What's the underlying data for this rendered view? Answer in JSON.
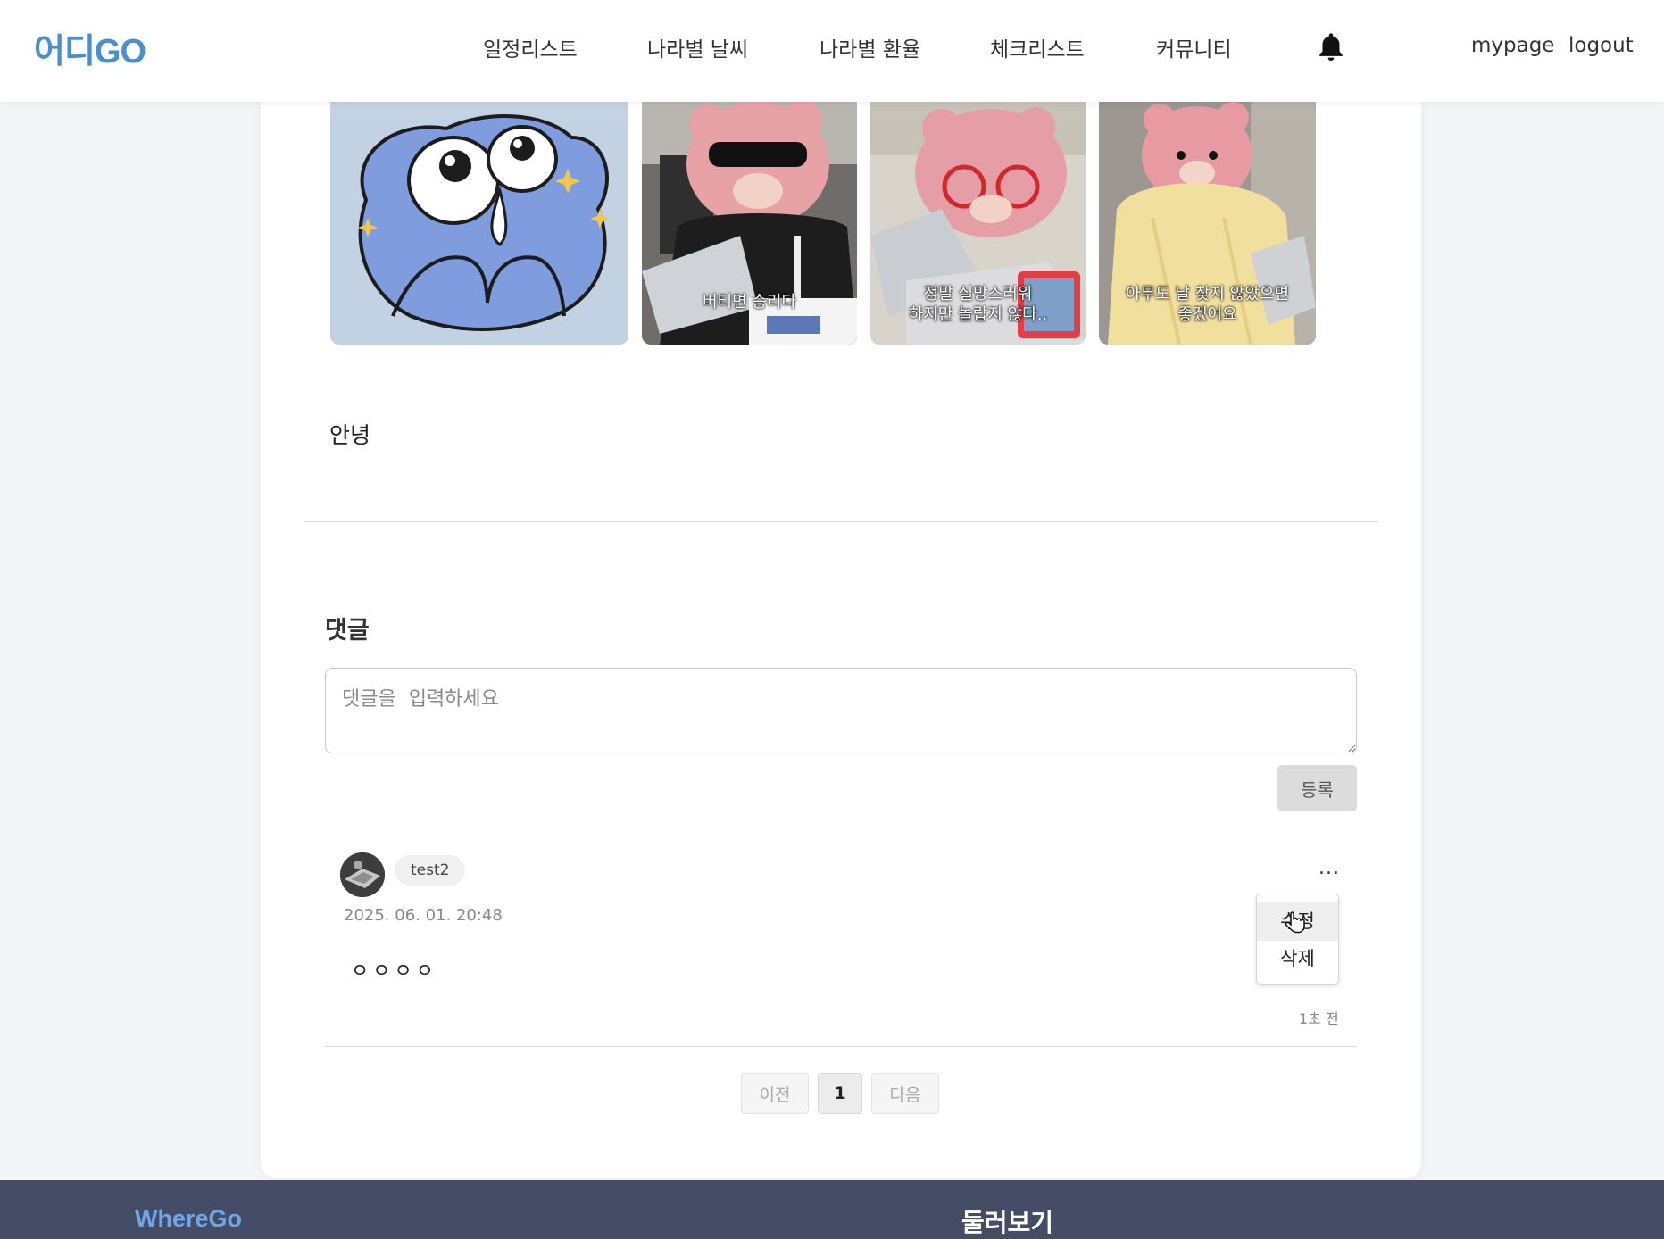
{
  "header": {
    "logo": "어디GO",
    "nav": [
      "일정리스트",
      "나라별 날씨",
      "나라별 환율",
      "체크리스트",
      "커뮤니티"
    ],
    "bell_icon": "bell-icon",
    "mypage": "mypage",
    "logout": "logout",
    "brand_color": "#4a90d0"
  },
  "post": {
    "images": [
      {
        "caption": ""
      },
      {
        "caption": "버티면 승리다"
      },
      {
        "caption": "정말 실망스러워\n하지만 놀랍지 않다.."
      },
      {
        "caption": "아무도 날 찾지 않았으면\n좋겠어요"
      }
    ],
    "body": "안녕"
  },
  "comments": {
    "heading": "댓글",
    "input_placeholder": "댓글을  입력하세요",
    "submit_label": "등록",
    "items": [
      {
        "author": "test2",
        "date": "2025. 06. 01. 20:48",
        "text": "ㅇㅇㅇㅇ",
        "time_ago": "1초 전",
        "more_label": "...",
        "menu": [
          "수정",
          "삭제"
        ]
      }
    ]
  },
  "pagination": {
    "prev": "이전",
    "current": "1",
    "next": "다음"
  },
  "footer": {
    "brand": "WhereGo",
    "title": "둘러보기",
    "bg_color": "#444c66"
  }
}
